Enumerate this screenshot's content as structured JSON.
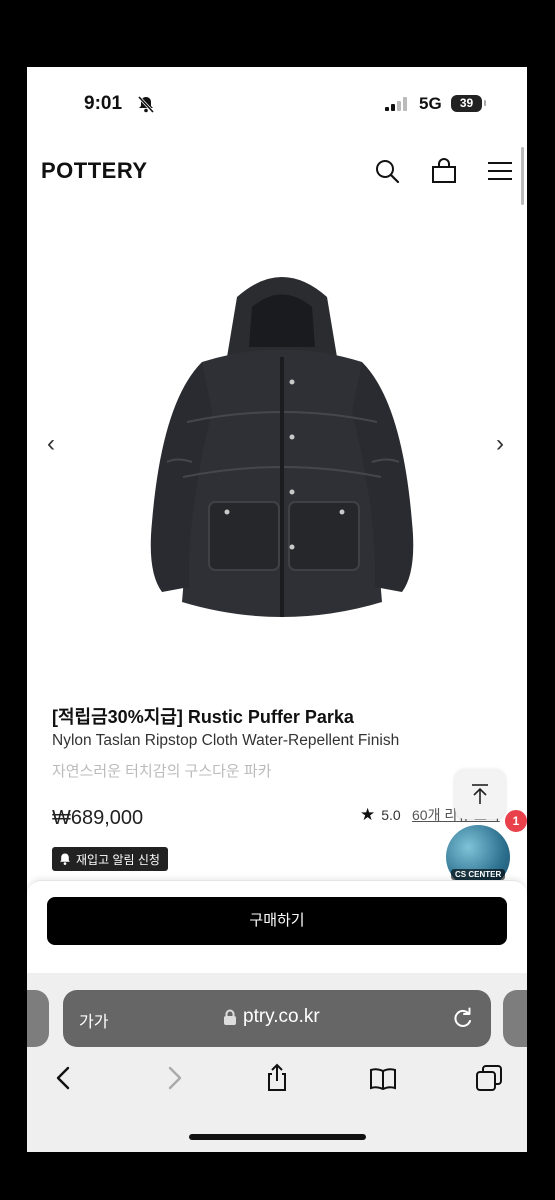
{
  "status_bar": {
    "time": "9:01",
    "network": "5G",
    "battery": "39"
  },
  "header": {
    "logo": "POTTERY"
  },
  "carousel": {
    "prev": "‹",
    "next": "›"
  },
  "product": {
    "title": "[적립금30%지급] Rustic Puffer Parka",
    "subtitle": "Nylon Taslan Ripstop Cloth Water-Repellent Finish",
    "description": "자연스러운 터치감의 구스다운 파카",
    "price": "₩689,000",
    "rating": "5.0",
    "reviews": "60개 리뷰 보기",
    "restock_label": "재입고 알림 신청"
  },
  "floating": {
    "badge_count": "1",
    "globe_label": "CS CENTER"
  },
  "purchase": {
    "buy_label": "구매하기"
  },
  "browser": {
    "aa": "가가",
    "url": "ptry.co.kr"
  }
}
